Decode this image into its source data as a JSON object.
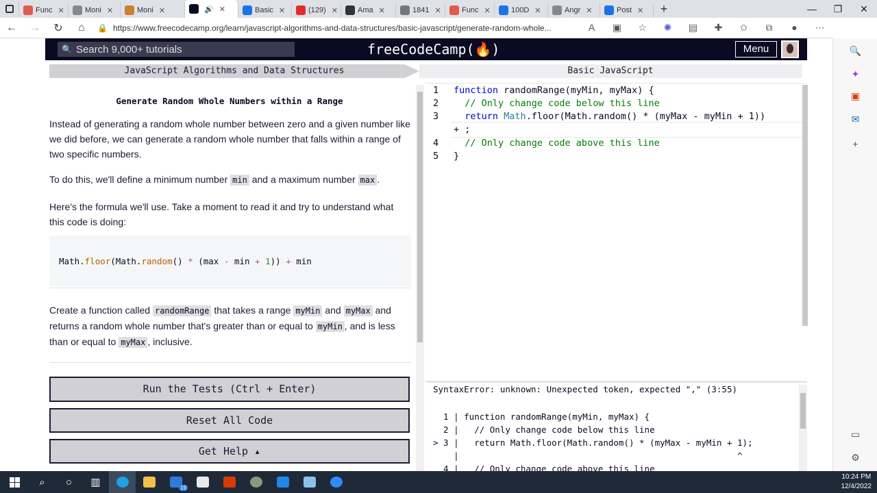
{
  "browser": {
    "tabs": [
      {
        "label": "Func",
        "color": "#e05a4e"
      },
      {
        "label": "Moni",
        "color": "#888"
      },
      {
        "label": "Moni",
        "color": "#c9812e"
      },
      {
        "label": "",
        "color": "#0a0a23",
        "active": true
      },
      {
        "label": "Basic",
        "color": "#1b73e8"
      },
      {
        "label": "(129)",
        "color": "#e12b2b"
      },
      {
        "label": "Ama",
        "color": "#333"
      },
      {
        "label": "1841",
        "color": "#777"
      },
      {
        "label": "Func",
        "color": "#e05a4e"
      },
      {
        "label": "100D",
        "color": "#1b73e8"
      },
      {
        "label": "Angr",
        "color": "#888"
      },
      {
        "label": "Post",
        "color": "#1b73e8"
      }
    ],
    "new_tab": "+",
    "url": "https://www.freecodecamp.org/learn/javascript-algorithms-and-data-structures/basic-javascript/generate-random-whole..."
  },
  "nav": {
    "search_placeholder": "Search 9,000+ tutorials",
    "logo": "freeCodeCamp(🔥)",
    "menu_label": "Menu"
  },
  "breadcrumb": {
    "superblock": "JavaScript Algorithms and Data Structures",
    "block": "Basic JavaScript"
  },
  "lesson": {
    "title": "Generate Random Whole Numbers within a Range",
    "p1": "Instead of generating a random whole number between zero and a given number like we did before, we can generate a random whole number that falls within a range of two specific numbers.",
    "p2_a": "To do this, we'll define a minimum number ",
    "p2_code1": "min",
    "p2_b": " and a maximum number ",
    "p2_code2": "max",
    "p2_c": ".",
    "p3": "Here's the formula we'll use. Take a moment to read it and try to understand what this code is doing:",
    "formula": {
      "t1": "Math.",
      "t2": "floor",
      "t3": "(Math.",
      "t4": "random",
      "t5": "() ",
      "t6": "*",
      "t7": " (max ",
      "t8": "-",
      "t9": " min ",
      "t10": "+",
      "t11": " ",
      "t12": "1",
      "t13": ")) ",
      "t14": "+",
      "t15": " min"
    },
    "p4_a": "Create a function called ",
    "p4_code1": "randomRange",
    "p4_b": " that takes a range ",
    "p4_code2": "myMin",
    "p4_c": " and ",
    "p4_code3": "myMax",
    "p4_d": " and returns a random whole number that's greater than or equal to ",
    "p4_code4": "myMin",
    "p4_e": ", and is less than or equal to ",
    "p4_code5": "myMax",
    "p4_f": ", inclusive.",
    "run_button": "Run the Tests (Ctrl + Enter)",
    "reset_button": "Reset All Code",
    "help_button": "Get Help ▴"
  },
  "editor": {
    "lines": [
      {
        "n": "1",
        "kw": "function",
        "rest": " randomRange(myMin, myMax) {"
      },
      {
        "n": "2",
        "cm": "  // Only change code below this line"
      },
      {
        "n": "3",
        "kw": "  return",
        "cls": " Math",
        "rest": ".floor(Math.random() * (myMax - myMin + 1))"
      },
      {
        "n": "",
        "rest": "+ ;"
      },
      {
        "n": "4",
        "cm": "  // Only change code above this line"
      },
      {
        "n": "5",
        "rest": "}"
      }
    ]
  },
  "console": {
    "error": "SyntaxError: unknown: Unexpected token, expected \",\" (3:55)",
    "lines": [
      "  1 | function randomRange(myMin, myMax) {",
      "  2 |   // Only change code below this line",
      "> 3 |   return Math.floor(Math.random() * (myMax - myMin + 1);",
      "    |                                                      ^",
      "  4 |   // Only change code above this line"
    ]
  },
  "taskbar": {
    "mail_badge": "19",
    "time": "10:24 PM",
    "date": "12/4/2022"
  }
}
